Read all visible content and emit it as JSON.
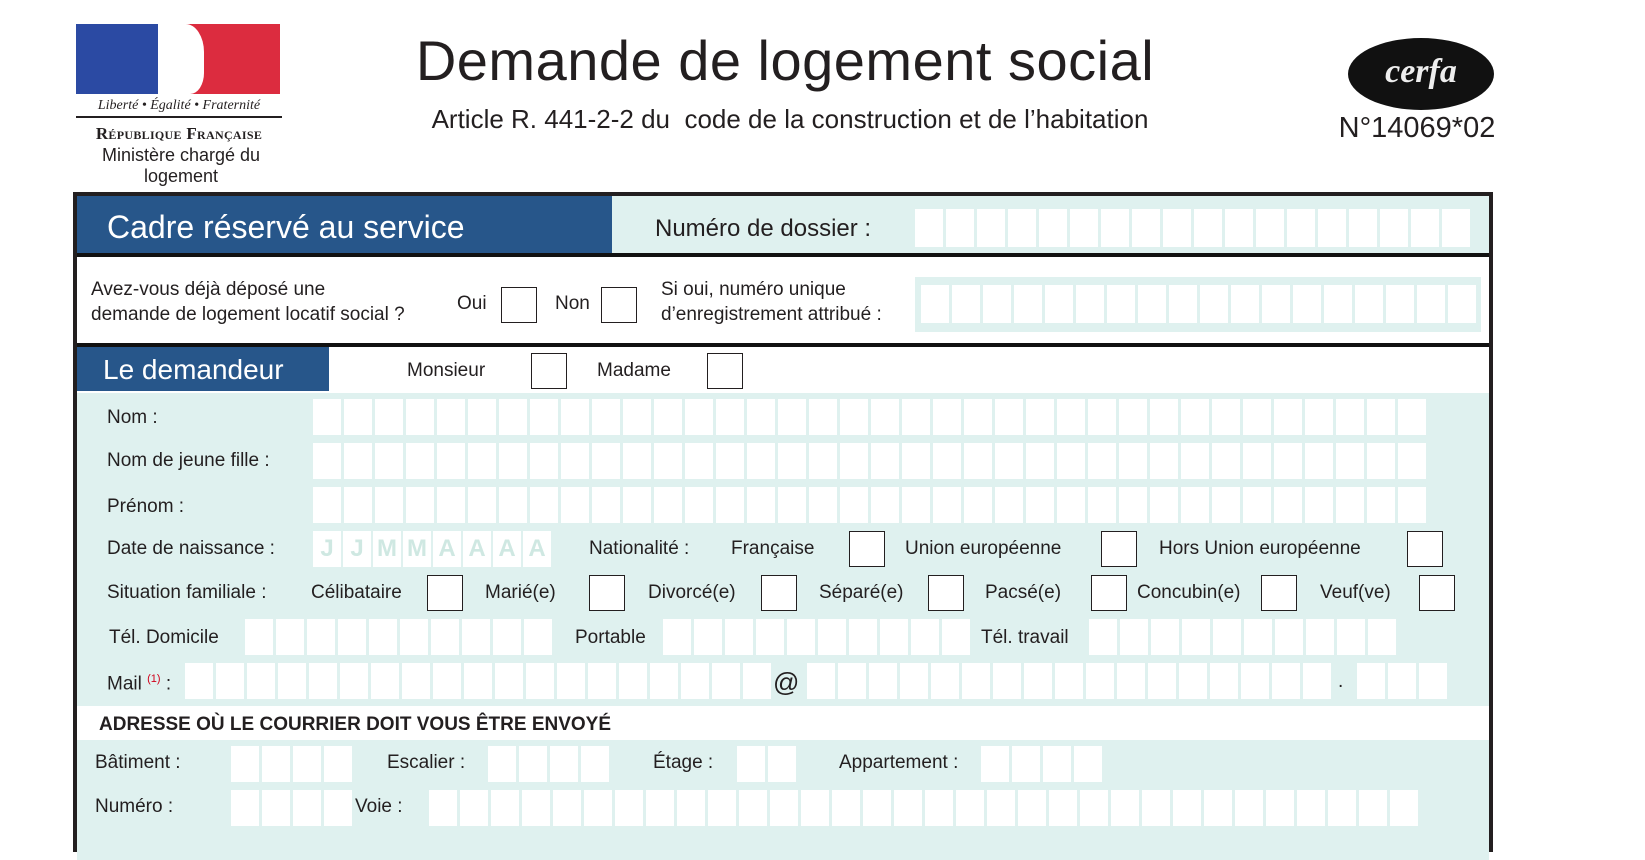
{
  "header": {
    "motto": "Liberté • Égalité • Fraternité",
    "republic": "République Française",
    "ministry": "Ministère chargé du logement",
    "title": "Demande de logement social",
    "subtitle": "Article R. 441-2-2 du  code de la construction et de l’habitation",
    "cerfa_logo": "cerfa",
    "cerfa_number": "N°14069*02"
  },
  "service": {
    "heading": "Cadre réservé au service",
    "dossier_label": "Numéro de dossier :",
    "dossier_cells": 18
  },
  "prior_request": {
    "question": "Avez-vous déjà déposé une demande de logement locatif social ?",
    "question_line1": "Avez-vous déjà déposé une",
    "question_line2": "demande de logement locatif social ?",
    "yes": "Oui",
    "no": "Non",
    "number_label_line1": "Si oui, numéro unique",
    "number_label_line2": "d’enregistrement attribué :",
    "number_cells": 18
  },
  "applicant": {
    "heading": "Le demandeur",
    "civility": [
      "Monsieur",
      "Madame"
    ],
    "nom_label": "Nom :",
    "nom_jeune_fille_label": "Nom de jeune fille :",
    "prenom_label": "Prénom :",
    "name_cells": 36,
    "birth_label": "Date de naissance :",
    "birth_placeholder": [
      "J",
      "J",
      "M",
      "M",
      "A",
      "A",
      "A",
      "A"
    ],
    "nationality_label": "Nationalité :",
    "nationality_options": [
      "Française",
      "Union européenne",
      "Hors Union européenne"
    ],
    "family_label": "Situation familiale :",
    "family_options": [
      "Célibataire",
      "Marié(e)",
      "Divorcé(e)",
      "Séparé(e)",
      "Pacsé(e)",
      "Concubin(e)",
      "Veuf(ve)"
    ],
    "tel_home_label": "Tél.  Domicile",
    "tel_mobile_label": "Portable",
    "tel_work_label": "Tél. travail",
    "phone_cells": 10,
    "mail_label": "Mail",
    "mail_note": "(1)",
    "mail_colon": ":",
    "mail_at": "@",
    "mail_dot": "."
  },
  "address": {
    "heading": "ADRESSE OÙ LE COURRIER DOIT VOUS ÊTRE ENVOYÉ",
    "batiment_label": "Bâtiment :",
    "escalier_label": "Escalier :",
    "etage_label": "Étage :",
    "appartement_label": "Appartement :",
    "numero_label": "Numéro :",
    "voie_label": "Voie :"
  },
  "colors": {
    "primary_blue": "#27568a",
    "panel_teal": "#dff1ef",
    "note_red": "#d0021b"
  }
}
